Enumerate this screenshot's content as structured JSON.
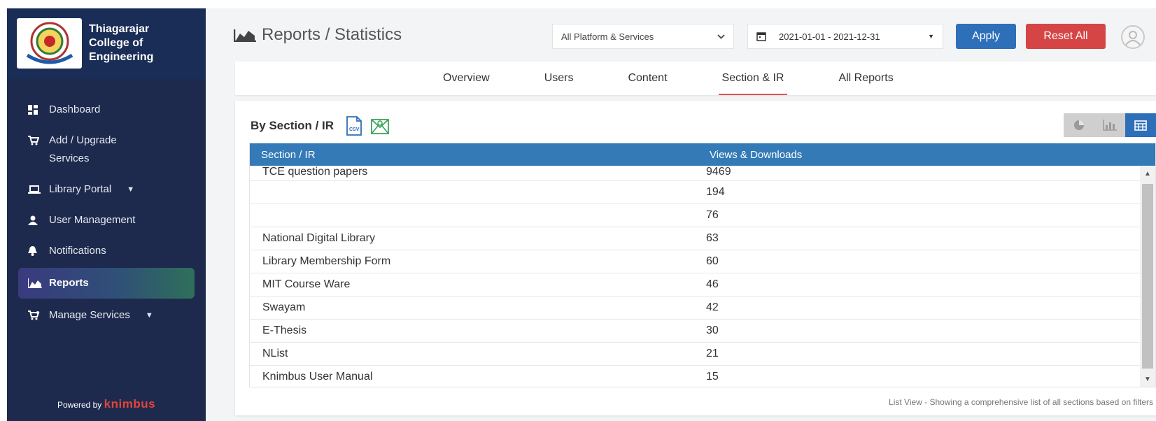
{
  "sidebar": {
    "college_name": "Thiagarajar College of Engineering",
    "items": [
      {
        "label": "Dashboard",
        "icon": "dashboard-icon"
      },
      {
        "label": "Add / Upgrade Services",
        "icon": "cart-icon"
      },
      {
        "label": "Library Portal",
        "icon": "laptop-icon",
        "has_caret": true
      },
      {
        "label": "User Management",
        "icon": "user-icon"
      },
      {
        "label": "Notifications",
        "icon": "bell-icon"
      },
      {
        "label": "Reports",
        "icon": "area-chart-icon",
        "active": true
      },
      {
        "label": "Manage Services",
        "icon": "cart-settings-icon",
        "has_caret": true
      }
    ],
    "powered_prefix": "Powered by",
    "powered_brand": "knimbus"
  },
  "header": {
    "title": "Reports / Statistics",
    "platform_select": "All Platform & Services",
    "date_range": "2021-01-01 - 2021-12-31",
    "apply_label": "Apply",
    "reset_label": "Reset All"
  },
  "tabs": [
    {
      "label": "Overview"
    },
    {
      "label": "Users"
    },
    {
      "label": "Content"
    },
    {
      "label": "Section & IR",
      "active": true
    },
    {
      "label": "All Reports"
    }
  ],
  "card": {
    "title": "By Section / IR",
    "columns": [
      "Section / IR",
      "Views & Downloads"
    ],
    "rows": [
      {
        "section": "TCE question papers",
        "views": "9469"
      },
      {
        "section": "",
        "views": "194"
      },
      {
        "section": "",
        "views": "76"
      },
      {
        "section": "National Digital Library",
        "views": "63"
      },
      {
        "section": "Library Membership Form",
        "views": "60"
      },
      {
        "section": "MIT Course Ware",
        "views": "46"
      },
      {
        "section": "Swayam",
        "views": "42"
      },
      {
        "section": "E-Thesis",
        "views": "30"
      },
      {
        "section": "NList",
        "views": "21"
      },
      {
        "section": "Knimbus User Manual",
        "views": "15"
      }
    ],
    "footnote": "List View - Showing a comprehensive list of all sections based on filters"
  },
  "colors": {
    "sidebar_bg": "#1d2a4d",
    "accent_blue": "#2e6fba",
    "reset_red": "#d64545",
    "table_header": "#337ab7",
    "brand_orange": "#e4453a"
  }
}
